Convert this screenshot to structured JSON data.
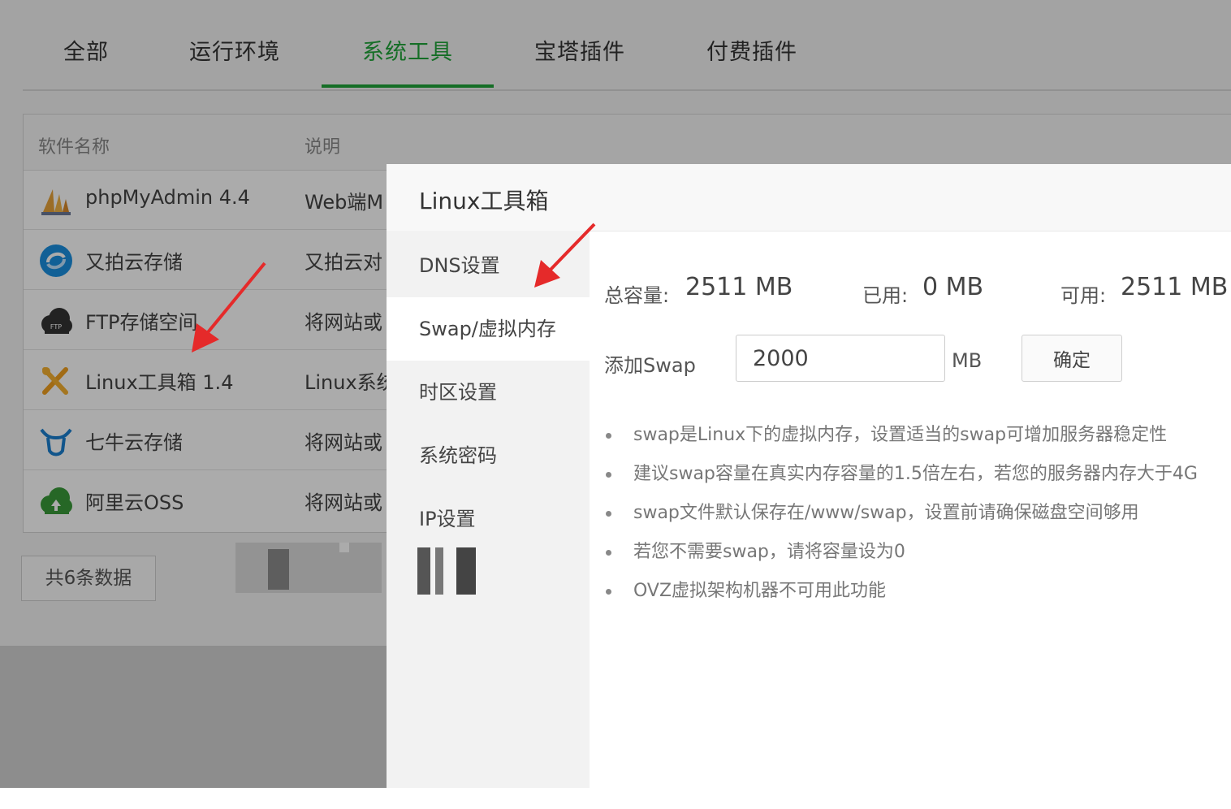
{
  "tabs": {
    "items": [
      {
        "label": "全部"
      },
      {
        "label": "运行环境"
      },
      {
        "label": "系统工具",
        "active": true
      },
      {
        "label": "宝塔插件"
      },
      {
        "label": "付费插件"
      }
    ]
  },
  "table": {
    "headers": {
      "name": "软件名称",
      "desc": "说明"
    },
    "rows": [
      {
        "name": "phpMyAdmin 4.4",
        "desc": "Web端M",
        "icon": "phpmyadmin-icon"
      },
      {
        "name": "又拍云存储",
        "desc": "又拍云对",
        "icon": "upyun-icon"
      },
      {
        "name": "FTP存储空间",
        "desc": "将网站或",
        "icon": "ftp-cloud-icon"
      },
      {
        "name": "Linux工具箱 1.4",
        "desc": "Linux系统",
        "icon": "tools-icon"
      },
      {
        "name": "七牛云存储",
        "desc": "将网站或",
        "icon": "qiniu-icon"
      },
      {
        "name": "阿里云OSS",
        "desc": "将网站或",
        "icon": "aliyun-icon"
      }
    ]
  },
  "pager": {
    "label": "共6条数据"
  },
  "dialog": {
    "title": "Linux工具箱",
    "menu": [
      {
        "label": "DNS设置"
      },
      {
        "label": "Swap/虚拟内存",
        "active": true
      },
      {
        "label": "时区设置"
      },
      {
        "label": "系统密码"
      },
      {
        "label": "IP设置"
      }
    ],
    "stats": {
      "total_label": "总容量:",
      "total_value": "2511 MB",
      "used_label": "已用:",
      "used_value": "0 MB",
      "avail_label": "可用:",
      "avail_value": "2511 MB"
    },
    "add_swap": {
      "label": "添加Swap",
      "value": "2000",
      "unit": "MB",
      "confirm_label": "确定"
    },
    "tips": [
      "swap是Linux下的虚拟内存，设置适当的swap可增加服务器稳定性",
      "建议swap容量在真实内存容量的1.5倍左右，若您的服务器内存大于4G",
      "swap文件默认保存在/www/swap，设置前请确保磁盘空间够用",
      "若您不需要swap，请将容量设为0",
      "OVZ虚拟架构机器不可用此功能"
    ]
  },
  "colors": {
    "accent": "#20a53a",
    "arrow": "#e52a2a"
  }
}
